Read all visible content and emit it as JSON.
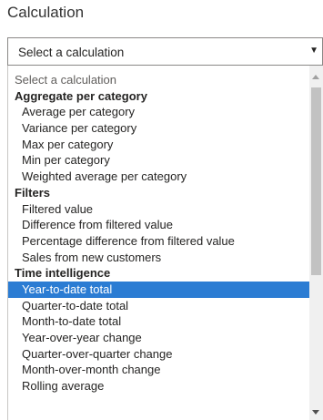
{
  "field_label": "Calculation",
  "select": {
    "value": "Select a calculation",
    "arrow": "▼"
  },
  "list": {
    "placeholder": "Select a calculation",
    "groups": [
      {
        "header": "Aggregate per category",
        "items": [
          "Average per category",
          "Variance per category",
          "Max per category",
          "Min per category",
          "Weighted average per category"
        ]
      },
      {
        "header": "Filters",
        "items": [
          "Filtered value",
          "Difference from filtered value",
          "Percentage difference from filtered value",
          "Sales from new customers"
        ]
      },
      {
        "header": "Time intelligence",
        "items": [
          "Year-to-date total",
          "Quarter-to-date total",
          "Month-to-date total",
          "Year-over-year change",
          "Quarter-over-quarter change",
          "Month-over-month change",
          "Rolling average"
        ]
      }
    ],
    "selected_item": "Year-to-date total"
  },
  "colors": {
    "selected_bg": "#2b7cd3",
    "scroll_track": "#f0f0f0",
    "scroll_thumb": "#c2c2c2"
  },
  "icons": {
    "dropdown": "chevron-down-icon",
    "scroll_up": "scroll-up-arrow-icon",
    "scroll_down": "scroll-down-arrow-icon"
  }
}
